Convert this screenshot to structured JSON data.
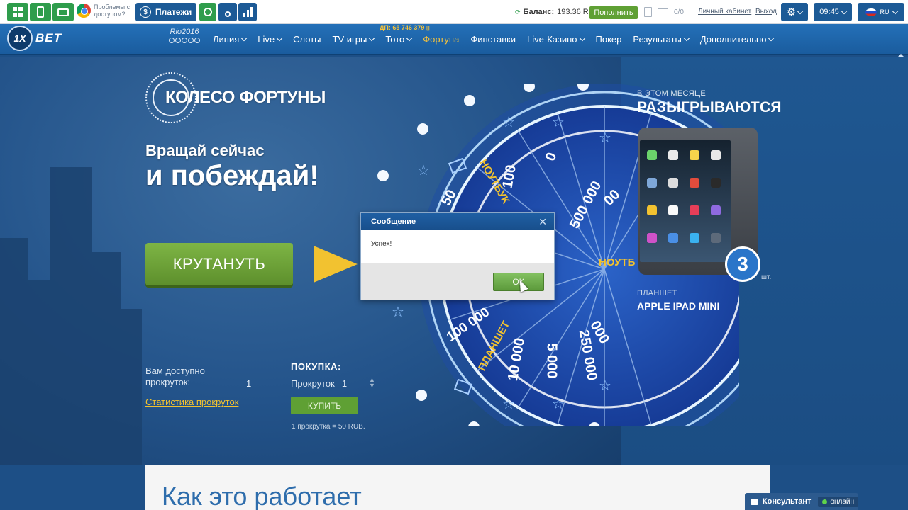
{
  "topbar": {
    "problem_text": "Проблемы с доступом?",
    "payments_label": "Платежи",
    "balance_label": "Баланс:",
    "balance_value": "193.36 RUB",
    "refill_label": "Пополнить",
    "messages_count": "0/0",
    "cabinet_link": "Личный кабинет",
    "logout_link": "Выход",
    "time": "09:45",
    "lang": "RU"
  },
  "header": {
    "logo_text": "BET",
    "logo_mark": "1X",
    "rio_text": "Rio2016",
    "phone": "ДП: 65 746 379 ▯",
    "nav": [
      {
        "label": "Линия",
        "has_menu": true,
        "active": false
      },
      {
        "label": "Live",
        "has_menu": true,
        "active": false
      },
      {
        "label": "Слоты",
        "has_menu": false,
        "active": false
      },
      {
        "label": "TV игры",
        "has_menu": true,
        "active": false
      },
      {
        "label": "Тото",
        "has_menu": true,
        "active": false
      },
      {
        "label": "Фортуна",
        "has_menu": false,
        "active": true
      },
      {
        "label": "Финставки",
        "has_menu": false,
        "active": false
      },
      {
        "label": "Live-Казино",
        "has_menu": true,
        "active": false
      },
      {
        "label": "Покер",
        "has_menu": false,
        "active": false
      },
      {
        "label": "Результаты",
        "has_menu": true,
        "active": false
      },
      {
        "label": "Дополнительно",
        "has_menu": true,
        "active": false
      }
    ]
  },
  "main": {
    "wheel_title": "КОЛЕСО ФОРТУНЫ",
    "spin_now": "Вращай сейчас",
    "and_win": "и побеждай!",
    "spin_button": "КРУТАНУТЬ",
    "available_label": "Вам доступно прокруток:",
    "available_count": "1",
    "stats_link": "Статистика прокруток",
    "purchase_title": "ПОКУПКА:",
    "spins_label": "Прокруток",
    "spins_value": "1",
    "buy_button": "КУПИТЬ",
    "price_note": "1 прокрутка = 50 RUB."
  },
  "wheel": {
    "segments_text": [
      "100",
      "0",
      "500 000",
      "50",
      "НОУТБУК",
      "100 000",
      "ПЛАНШЕТ",
      "10 000",
      "5 000",
      "250 000",
      "НОУТБУК"
    ],
    "partial_text": [
      "500",
      "00",
      "НОУТБ",
      "0",
      "000"
    ]
  },
  "promo": {
    "month_label": "В ЭТОМ МЕСЯЦЕ",
    "played_label": "РАЗЫГРЫВАЮТСЯ",
    "count": "3",
    "pcs": "шт.",
    "tablet_label": "ПЛАНШЕТ",
    "prize_name": "APPLE IPAD MINI"
  },
  "how": {
    "title": "Как это работает"
  },
  "consultant": {
    "label": "Консультант",
    "status": "онлайн"
  },
  "dialog": {
    "title": "Сообщение",
    "message": "Успех!",
    "ok_label": "OK"
  },
  "colors": {
    "accent_yellow": "#f2c230",
    "green_button": "#5fa034",
    "header_blue": "#1c5a96"
  }
}
